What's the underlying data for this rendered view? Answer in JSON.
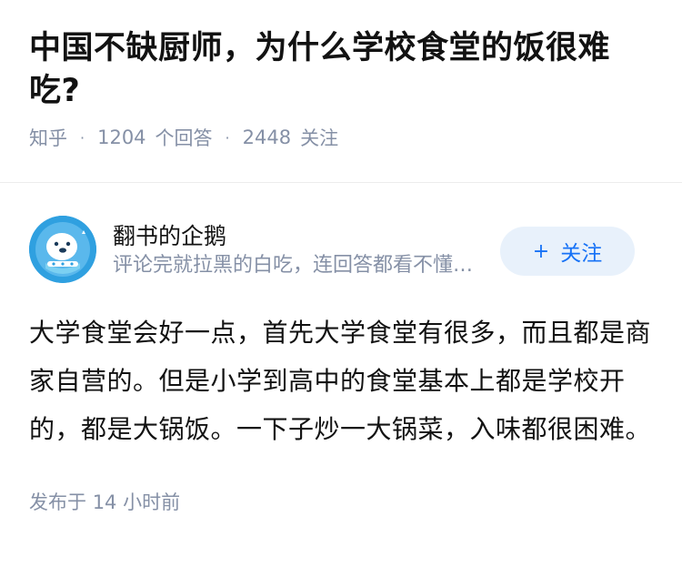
{
  "question": {
    "title": "中国不缺厨师，为什么学校食堂的饭很难吃?",
    "source": "知乎",
    "answers_count": "1204",
    "answers_label": "个回答",
    "followers_count": "2448",
    "followers_label": "关注"
  },
  "answer": {
    "author_name": "翻书的企鹅",
    "author_bio": "评论完就拉黑的白吃，连回答都看不懂的也拉黑",
    "follow_label": "关注",
    "follow_icon": "plus-icon",
    "content": "大学食堂会好一点，首先大学食堂有很多，而且都是商家自营的。但是小学到高中的食堂基本上都是学校开的，都是大锅饭。一下子炒一大锅菜，入味都很困难。",
    "published_label": "发布于",
    "published_time": "14 小时前"
  },
  "colors": {
    "accent": "#1772f6",
    "muted": "#8590a6",
    "button_bg": "#e8f1fb",
    "avatar_bg": "#2fa0e0"
  }
}
